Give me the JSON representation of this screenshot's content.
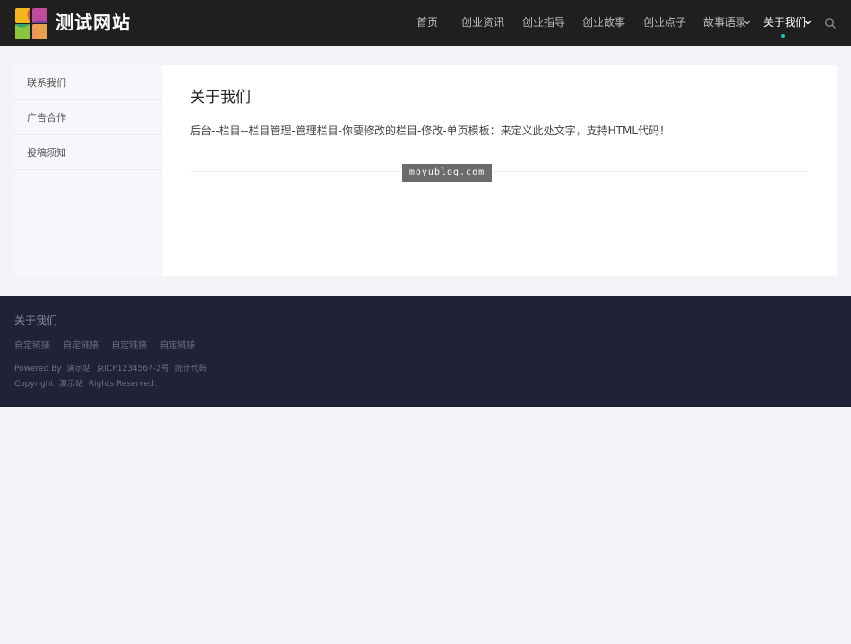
{
  "header": {
    "site_name": "测试网站",
    "nav": [
      {
        "label": "首页"
      },
      {
        "label": "创业资讯"
      },
      {
        "label": "创业指导"
      },
      {
        "label": "创业故事"
      },
      {
        "label": "创业点子"
      },
      {
        "label": "故事语录"
      },
      {
        "label": "关于我们"
      }
    ],
    "active_nav": "关于我们",
    "accent_color": "#1fc2b0"
  },
  "sidebar": {
    "items": [
      {
        "label": "联系我们"
      },
      {
        "label": "广告合作"
      },
      {
        "label": "投稿须知"
      }
    ]
  },
  "content": {
    "title": "关于我们",
    "body": "后台--栏目--栏目管理-管理栏目-你要修改的栏目-修改-单页模板：来定义此处文字，支持HTML代码！"
  },
  "watermark": "moyublog.com",
  "footer": {
    "title": "关于我们",
    "links": [
      "自定链接",
      "自定链接",
      "自定链接",
      "自定链接"
    ],
    "powered_by": "Powered By",
    "site": "演示站",
    "icp": "京ICP1234567-2号",
    "stats": "统计代码",
    "copyright_prefix": "Copyright",
    "copyright_suffix": "Rights Reserved."
  },
  "icons": {
    "logo": "colorful-pinwheel-logo",
    "search": "search-icon",
    "dropdown": "chevron-down-icon"
  }
}
